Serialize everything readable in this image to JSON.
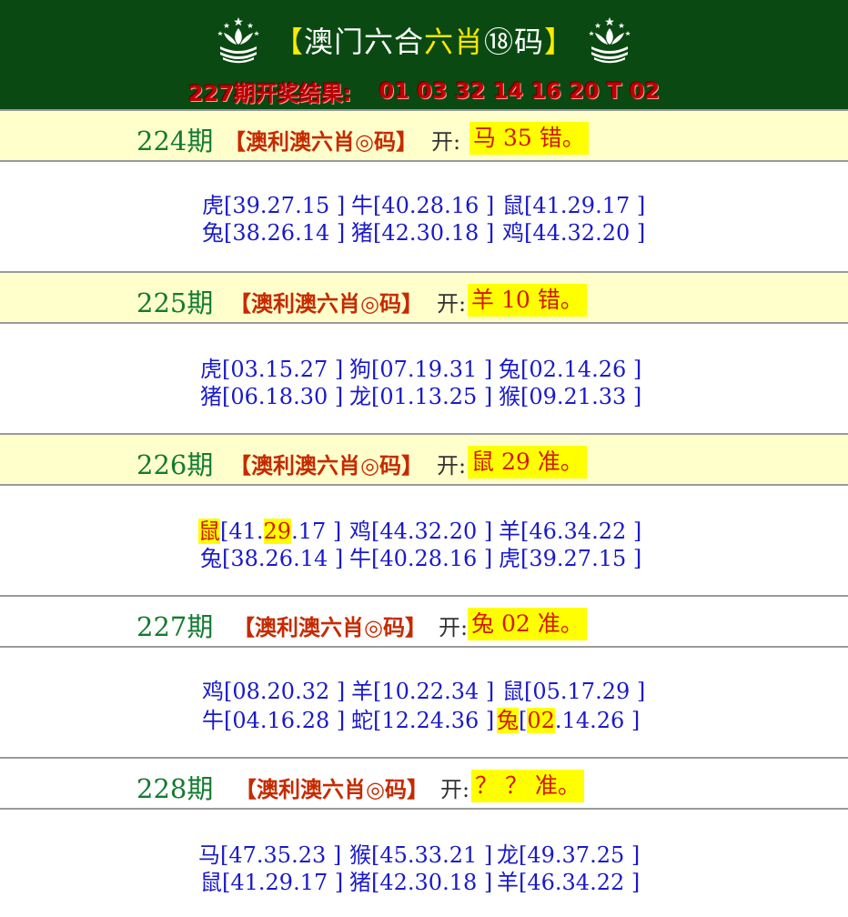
{
  "header": {
    "title_left_bracket": "【",
    "title_main": "澳门六合",
    "title_accent": "六肖",
    "title_tail": "⑱码",
    "title_right_bracket": "】",
    "result_label": "227期开奖结果:",
    "result_numbers": "01 03 32 14 16 20 T 02",
    "colors": {
      "background": "#0a4a12",
      "result": "#c00000",
      "accent": "#ffe600"
    }
  },
  "entries": [
    {
      "period": "224期",
      "label": "【澳利澳六肖◎码】",
      "open_prefix": "开:",
      "result": "马 35 错。",
      "rows": [
        [
          "虎[39.27.15 ]",
          "牛[40.28.16 ]",
          "鼠[41.29.17 ]"
        ],
        [
          "兔[38.26.14 ]",
          "猪[42.30.18 ]",
          "鸡[44.32.20 ]"
        ]
      ]
    },
    {
      "period": "225期",
      "label": "【澳利澳六肖◎码】",
      "open_prefix": "开:",
      "result": "羊 10 错。",
      "rows": [
        [
          "虎[03.15.27 ]",
          "狗[07.19.31 ]",
          "兔[02.14.26 ]"
        ],
        [
          "猪[06.18.30 ]",
          "龙[01.13.25 ]",
          "猴[09.21.33 ]"
        ]
      ]
    },
    {
      "period": "226期",
      "label": "【澳利澳六肖◎码】",
      "open_prefix": "开:",
      "result": "鼠 29 准。",
      "rows": [
        [
          "鼠[41.29.17 ]",
          "鸡[44.32.20 ]",
          "羊[46.34.22 ]"
        ],
        [
          "兔[38.26.14 ]",
          "牛[40.28.16 ]",
          "虎[39.27.15 ]"
        ]
      ]
    },
    {
      "period": "227期",
      "label": "【澳利澳六肖◎码】",
      "open_prefix": "开:",
      "result": "兔 02 准。",
      "rows": [
        [
          "鸡[08.20.32 ]",
          "羊[10.22.34 ]",
          "鼠[05.17.29 ]"
        ],
        [
          "牛[04.16.28 ]",
          "蛇[12.24.36 ]",
          "兔[02.14.26 ]"
        ]
      ]
    },
    {
      "period": "228期",
      "label": "【澳利澳六肖◎码】",
      "open_prefix": "开:",
      "result": "？ ？ 准。",
      "rows": [
        [
          "马[47.35.23 ]",
          "猴[45.33.21 ]",
          "龙[49.37.25 ]"
        ],
        [
          "鼠[41.29.17 ]",
          "猪[42.30.18 ]",
          "羊[46.34.22 ]"
        ]
      ]
    }
  ],
  "colors": {
    "period": "#137a31",
    "label": "#c62a00",
    "highlight": "#ffff00",
    "numbers": "#1a1ac8",
    "head_background": "#ffffcc"
  },
  "icons": {
    "logo": "macau-lotus-emblem-icon"
  }
}
